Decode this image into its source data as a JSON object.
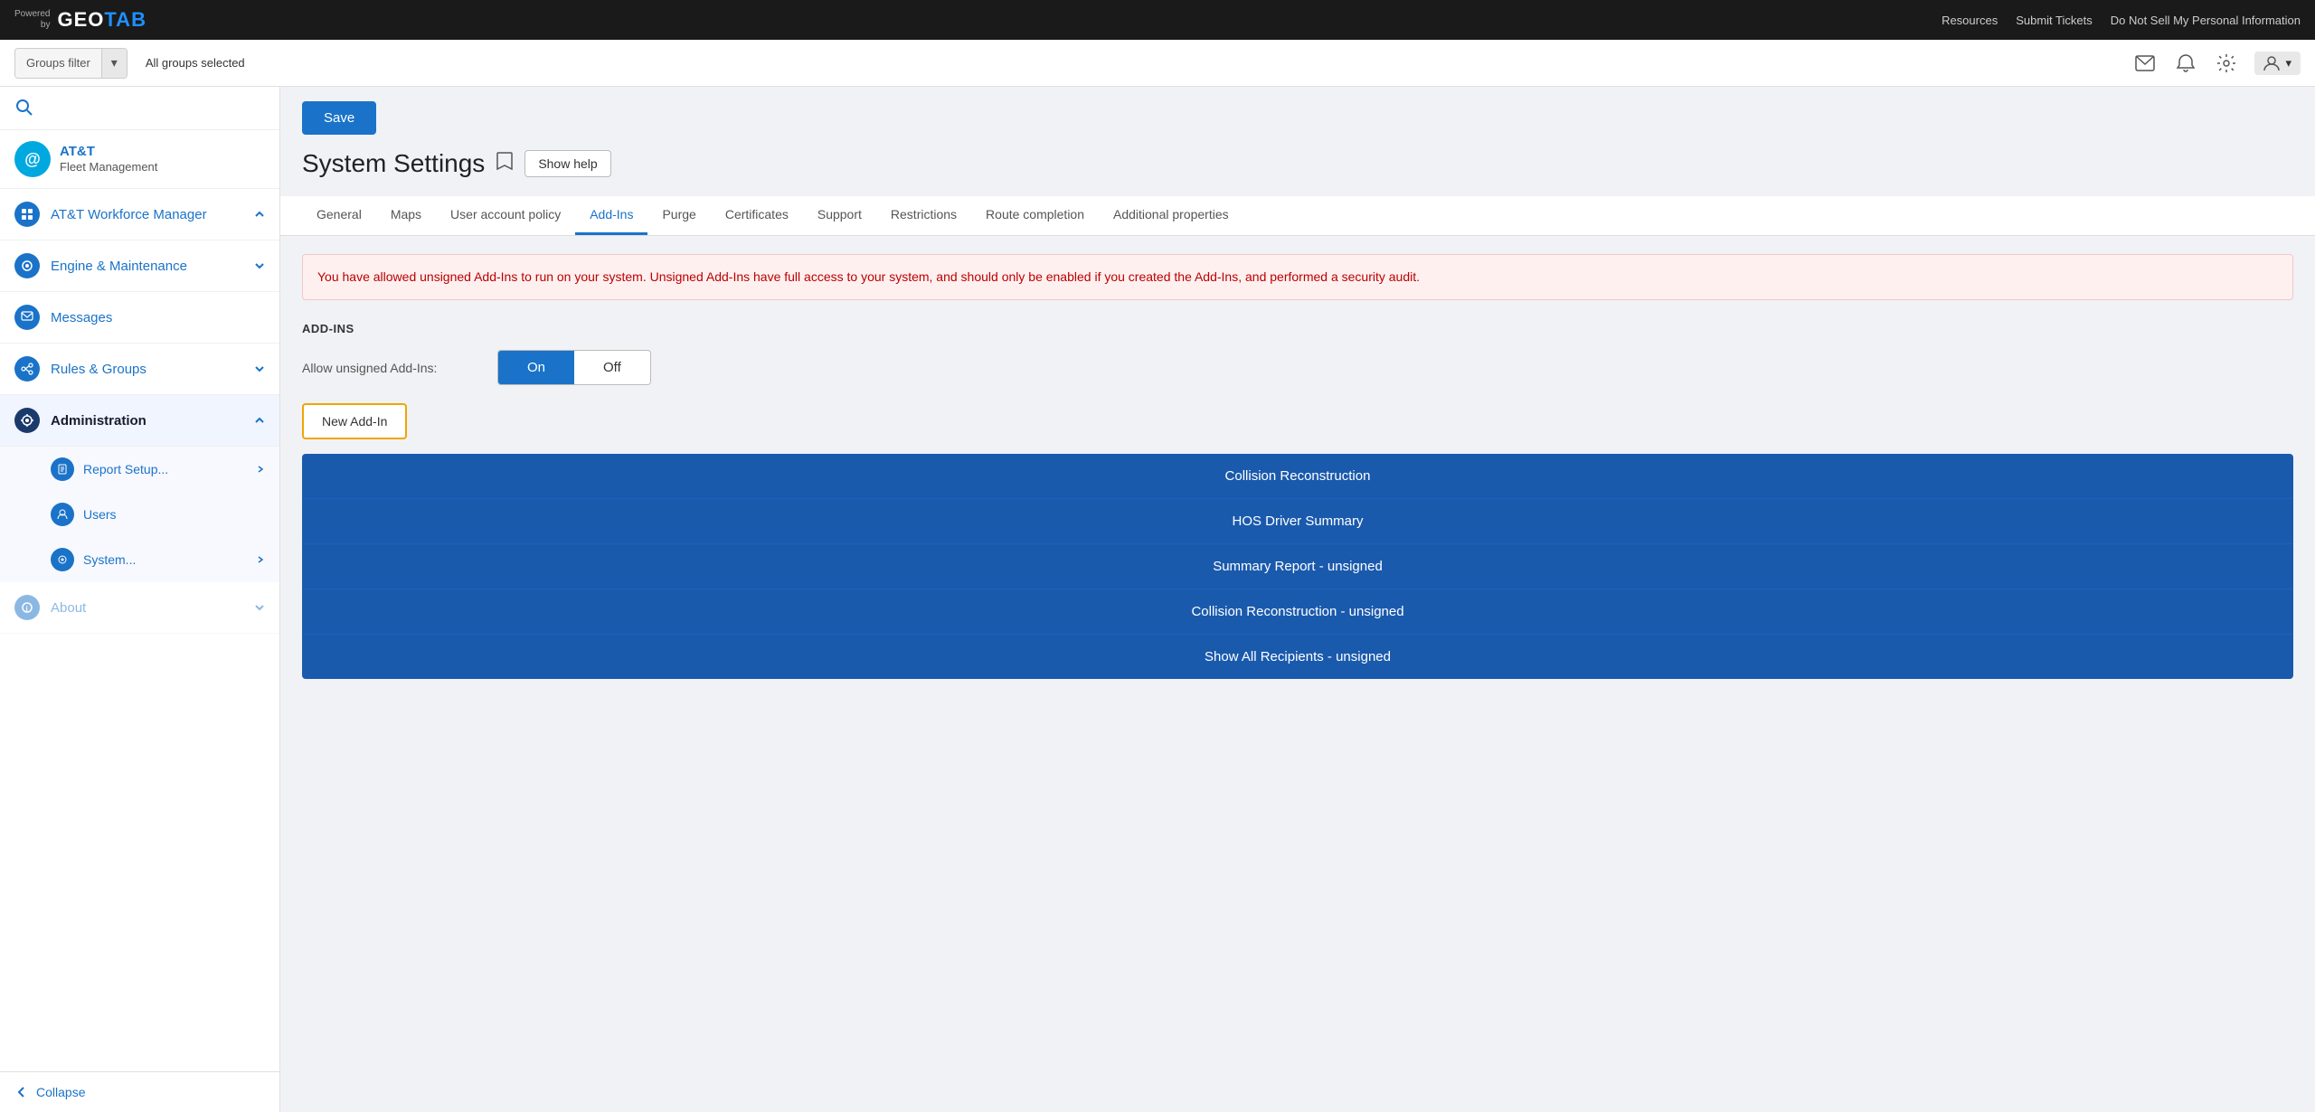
{
  "topnav": {
    "powered_by": "Powered\nby",
    "logo_geo": "GEO",
    "logo_tab": "TAB",
    "logo_full": "GEOTAB",
    "links": [
      "Resources",
      "Submit Tickets",
      "Do Not Sell My Personal Information"
    ]
  },
  "secondbar": {
    "groups_filter_label": "Groups filter",
    "all_groups_selected": "All groups selected"
  },
  "sidebar": {
    "app_name": "AT&T",
    "app_subtitle": "Fleet Management",
    "items": [
      {
        "label": "AT&T Workforce Manager",
        "icon": "grid",
        "hasChevron": true,
        "chevronDir": "up"
      },
      {
        "label": "Engine & Maintenance",
        "icon": "wrench",
        "hasChevron": true,
        "chevronDir": "down"
      },
      {
        "label": "Messages",
        "icon": "envelope",
        "hasChevron": false
      },
      {
        "label": "Rules & Groups",
        "icon": "rules",
        "hasChevron": true,
        "chevronDir": "down"
      },
      {
        "label": "Administration",
        "icon": "gear",
        "hasChevron": true,
        "chevronDir": "up",
        "active": true
      }
    ],
    "sub_items": [
      {
        "label": "Report Setup...",
        "icon": "report",
        "hasChevron": true
      },
      {
        "label": "Users",
        "icon": "user",
        "hasChevron": false
      },
      {
        "label": "System...",
        "icon": "system",
        "hasChevron": true
      }
    ],
    "about_label": "About",
    "collapse_label": "Collapse"
  },
  "header": {
    "save_label": "Save",
    "page_title": "System Settings",
    "show_help_label": "Show help"
  },
  "tabs": {
    "items": [
      {
        "label": "General",
        "active": false
      },
      {
        "label": "Maps",
        "active": false
      },
      {
        "label": "User account policy",
        "active": false
      },
      {
        "label": "Add-Ins",
        "active": true
      },
      {
        "label": "Purge",
        "active": false
      },
      {
        "label": "Certificates",
        "active": false
      },
      {
        "label": "Support",
        "active": false
      },
      {
        "label": "Restrictions",
        "active": false
      },
      {
        "label": "Route completion",
        "active": false
      },
      {
        "label": "Additional properties",
        "active": false
      }
    ]
  },
  "content": {
    "warning_text": "You have allowed unsigned Add-Ins to run on your system. Unsigned Add-Ins have full access to your system, and should only be enabled if you created the Add-Ins, and performed a security audit.",
    "section_title": "ADD-INS",
    "toggle_label": "Allow unsigned Add-Ins:",
    "toggle_on": "On",
    "toggle_off": "Off",
    "new_addin_label": "New Add-In",
    "addins": [
      "Collision Reconstruction",
      "HOS Driver Summary",
      "Summary Report - unsigned",
      "Collision Reconstruction - unsigned",
      "Show All Recipients - unsigned"
    ]
  }
}
